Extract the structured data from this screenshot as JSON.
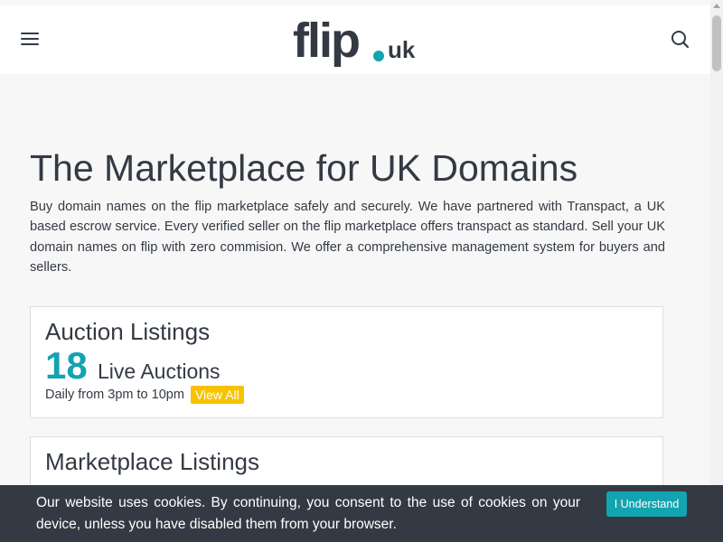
{
  "header": {
    "logo": {
      "word": "flip",
      "tld": "uk"
    },
    "menu_icon": "hamburger-icon",
    "search_icon": "search-icon"
  },
  "hero": {
    "title": "The Marketplace for UK Domains",
    "intro": "Buy domain names on the flip marketplace safely and securely. We have partnered with Transpact, a UK based escrow service. Every verified seller on the flip marketplace offers transpact as standard. Sell your UK domain names on flip with zero commision. We offer a comprehensive management system for buyers and sellers."
  },
  "auction_card": {
    "title": "Auction Listings",
    "count": "18",
    "count_label": "Live Auctions",
    "schedule": "Daily from 3pm to 10pm",
    "view_all_label": "View All"
  },
  "marketplace_card": {
    "title": "Marketplace Listings"
  },
  "cookie_banner": {
    "text": "Our website uses cookies. By continuing, you consent to the use of cookies on your device, unless you have disabled them from your browser.",
    "button_label": "I Understand"
  },
  "colors": {
    "accent": "#12a4b0",
    "text": "#333a43",
    "button_yellow": "#f7c300",
    "page_bg": "#f7f7f7"
  }
}
